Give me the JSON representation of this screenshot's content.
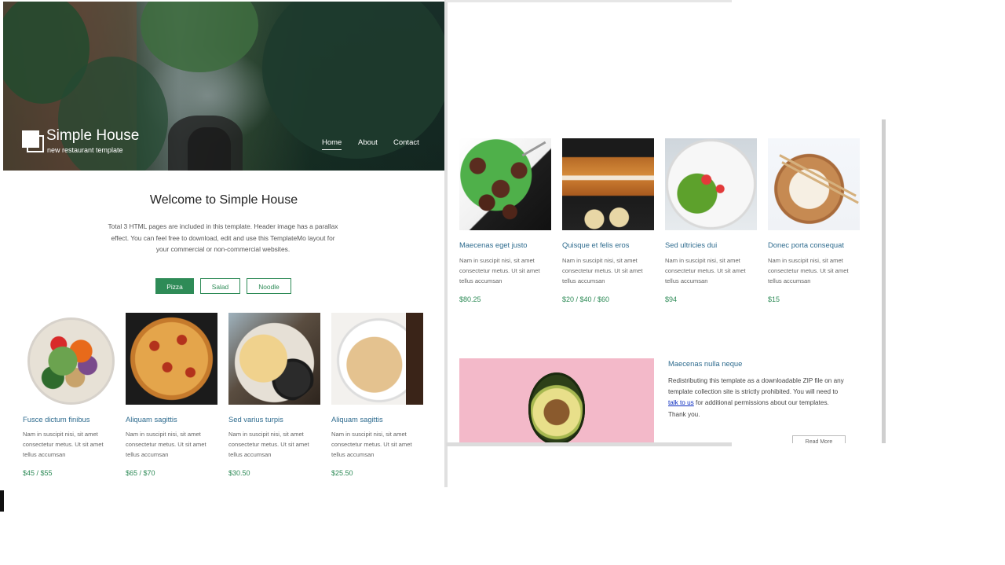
{
  "brand": {
    "title": "Simple House",
    "tagline": "new restaurant template"
  },
  "nav": {
    "items": [
      "Home",
      "About",
      "Contact"
    ],
    "active": "Home"
  },
  "welcome": {
    "title": "Welcome to Simple House",
    "text": "Total 3 HTML pages are included in this template. Header image has a parallax effect. You can feel free to download, edit and use this TemplateMo layout for your commercial or non-commercial websites."
  },
  "filters": {
    "tabs": [
      "Pizza",
      "Salad",
      "Noodle"
    ],
    "selected": "Pizza"
  },
  "left_cards": [
    {
      "title": "Fusce dictum finibus",
      "desc": "Nam in suscipit nisi, sit amet consectetur metus. Ut sit amet tellus accumsan",
      "price": "$45 / $55"
    },
    {
      "title": "Aliquam sagittis",
      "desc": "Nam in suscipit nisi, sit amet consectetur metus. Ut sit amet tellus accumsan",
      "price": "$65 / $70"
    },
    {
      "title": "Sed varius turpis",
      "desc": "Nam in suscipit nisi, sit amet consectetur metus. Ut sit amet tellus accumsan",
      "price": "$30.50"
    },
    {
      "title": "Aliquam sagittis",
      "desc": "Nam in suscipit nisi, sit amet consectetur metus. Ut sit amet tellus accumsan",
      "price": "$25.50"
    }
  ],
  "right_cards": [
    {
      "title": "Maecenas eget justo",
      "desc": "Nam in suscipit nisi, sit amet consectetur metus. Ut sit amet tellus accumsan",
      "price": "$80.25"
    },
    {
      "title": "Quisque et felis eros",
      "desc": "Nam in suscipit nisi, sit amet consectetur metus. Ut sit amet tellus accumsan",
      "price": "$20 / $40 / $60"
    },
    {
      "title": "Sed ultricies dui",
      "desc": "Nam in suscipit nisi, sit amet consectetur metus. Ut sit amet tellus accumsan",
      "price": "$94"
    },
    {
      "title": "Donec porta consequat",
      "desc": "Nam in suscipit nisi, sit amet consectetur metus. Ut sit amet tellus accumsan",
      "price": "$15"
    }
  ],
  "featured": {
    "title": "Maecenas nulla neque",
    "text_before_link": "Redistributing this template as a downloadable ZIP file on any template collection site is strictly prohibited. You will need to ",
    "link_text": "talk to us",
    "text_after_link": " for additional permissions about our templates. Thank you.",
    "button_label": "Read More"
  },
  "colors": {
    "accent": "#2e8b57",
    "title_blue": "#2f6c8f",
    "link_blue": "#0b2cc0",
    "featured_bg": "#f3b9c9"
  }
}
